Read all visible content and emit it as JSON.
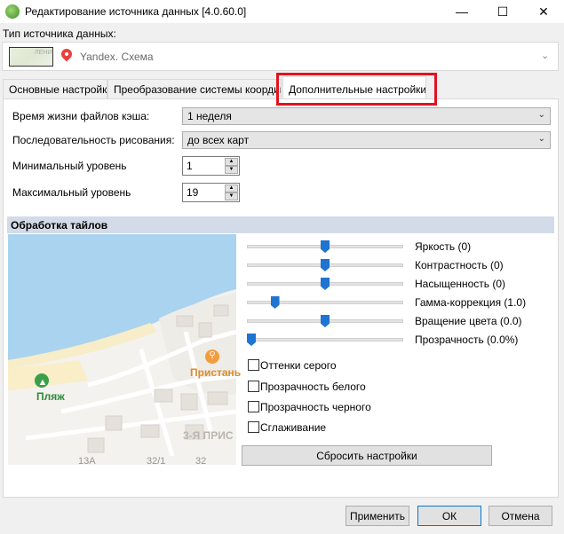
{
  "window": {
    "title": "Редактирование источника данных [4.0.60.0]",
    "controls": [
      "—",
      "☐",
      "✕"
    ]
  },
  "source": {
    "label": "Тип источника данных:",
    "thumb_text": "ЛЕНИ",
    "value": "Yandex. Схема"
  },
  "tabs": [
    {
      "label": "Основные настройки"
    },
    {
      "label": "Преобразование системы координат"
    },
    {
      "label": "Дополнительные настройки"
    }
  ],
  "settings": {
    "cache_label": "Время жизни файлов кэша:",
    "cache_value": "1 неделя",
    "order_label": "Последовательность рисования:",
    "order_value": "до всех карт",
    "min_label": "Минимальный уровень",
    "min_value": "1",
    "max_label": "Максимальный уровень",
    "max_value": "19"
  },
  "tiles": {
    "header": "Обработка тайлов",
    "sliders": [
      {
        "label": "Яркость (0)",
        "position": 0.5
      },
      {
        "label": "Контрастность (0)",
        "position": 0.5
      },
      {
        "label": "Насыщенность (0)",
        "position": 0.5
      },
      {
        "label": "Гамма-коррекция (1.0)",
        "position": 0.16
      },
      {
        "label": "Вращение цвета (0.0)",
        "position": 0.5
      },
      {
        "label": "Прозрачность (0.0%)",
        "position": 0.0
      }
    ],
    "checkboxes": [
      {
        "label": "Оттенки серого",
        "checked": false
      },
      {
        "label": "Прозрачность белого",
        "checked": false
      },
      {
        "label": "Прозрачность черного",
        "checked": false
      },
      {
        "label": "Сглаживание",
        "checked": false
      }
    ],
    "reset_label": "Сбросить настройки"
  },
  "map": {
    "beach": "Пляж",
    "pier": "Пристань",
    "street": "3-Я ПРИС",
    "numbers": [
      "13А",
      "32/1",
      "32"
    ]
  },
  "footer": {
    "apply": "Применить",
    "ok": "ОК",
    "cancel": "Отмена"
  },
  "colors": {
    "highlight": "#e2121f",
    "water": "#aad3ef",
    "beach_icon": "#3aa047",
    "pier_icon": "#f39c3b",
    "slider_thumb": "#1e74d0"
  }
}
